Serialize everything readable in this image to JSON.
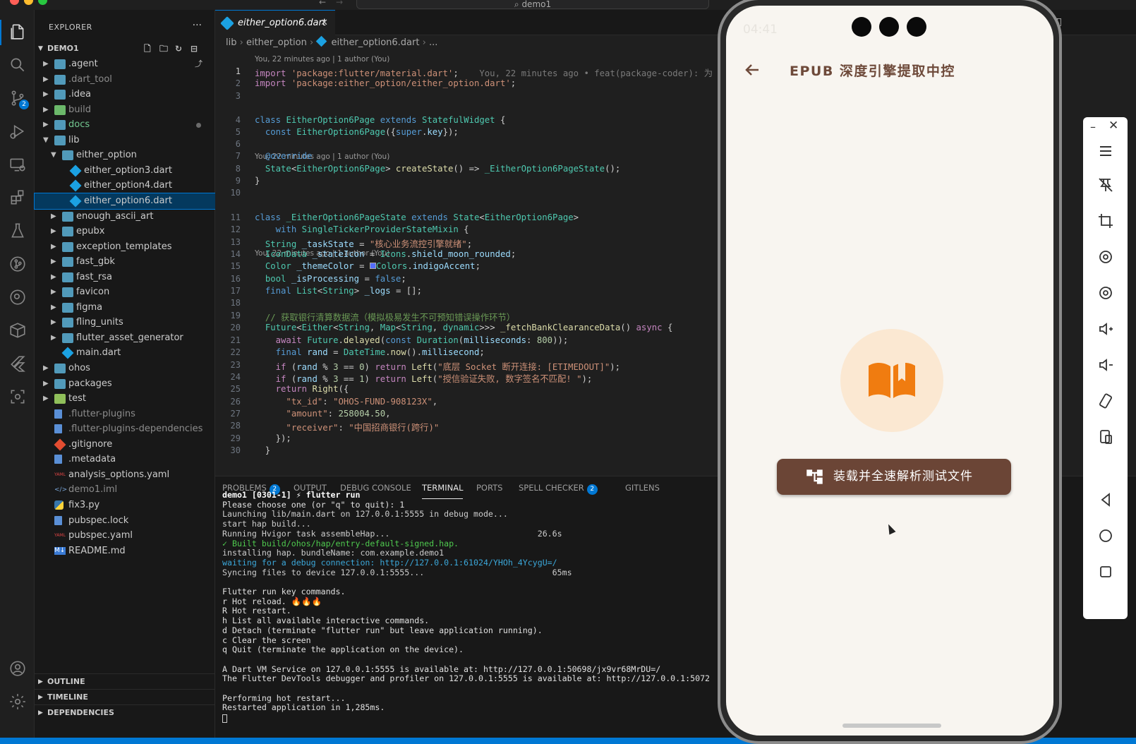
{
  "window": {
    "search_text": "demo1"
  },
  "activity": {
    "scm_badge": "2"
  },
  "explorer": {
    "title": "EXPLORER",
    "more": "···",
    "root": "DEMO1",
    "items": [
      {
        "label": ".agent",
        "kind": "folder",
        "depth": 0,
        "state": "closed"
      },
      {
        "label": ".dart_tool",
        "kind": "folder",
        "depth": 0,
        "state": "closed"
      },
      {
        "label": ".idea",
        "kind": "folder",
        "depth": 0,
        "state": "closed"
      },
      {
        "label": "build",
        "kind": "folder-build",
        "depth": 0,
        "state": "closed"
      },
      {
        "label": "docs",
        "kind": "folder",
        "depth": 0,
        "state": "closed"
      },
      {
        "label": "lib",
        "kind": "folder",
        "depth": 0,
        "state": "open"
      },
      {
        "label": "either_option",
        "kind": "folder",
        "depth": 1,
        "state": "open"
      },
      {
        "label": "either_option3.dart",
        "kind": "dart",
        "depth": 2
      },
      {
        "label": "either_option4.dart",
        "kind": "dart",
        "depth": 2
      },
      {
        "label": "either_option6.dart",
        "kind": "dart",
        "depth": 2,
        "selected": true
      },
      {
        "label": "enough_ascii_art",
        "kind": "folder",
        "depth": 1,
        "state": "closed"
      },
      {
        "label": "epubx",
        "kind": "folder",
        "depth": 1,
        "state": "closed"
      },
      {
        "label": "exception_templates",
        "kind": "folder",
        "depth": 1,
        "state": "closed"
      },
      {
        "label": "fast_gbk",
        "kind": "folder",
        "depth": 1,
        "state": "closed"
      },
      {
        "label": "fast_rsa",
        "kind": "folder",
        "depth": 1,
        "state": "closed"
      },
      {
        "label": "favicon",
        "kind": "folder",
        "depth": 1,
        "state": "closed"
      },
      {
        "label": "figma",
        "kind": "folder",
        "depth": 1,
        "state": "closed"
      },
      {
        "label": "fling_units",
        "kind": "folder",
        "depth": 1,
        "state": "closed"
      },
      {
        "label": "flutter_asset_generator",
        "kind": "folder",
        "depth": 1,
        "state": "closed"
      },
      {
        "label": "main.dart",
        "kind": "dart",
        "depth": 1
      },
      {
        "label": "ohos",
        "kind": "folder",
        "depth": 0,
        "state": "closed"
      },
      {
        "label": "packages",
        "kind": "folder",
        "depth": 0,
        "state": "closed"
      },
      {
        "label": "test",
        "kind": "folder-test",
        "depth": 0,
        "state": "closed"
      },
      {
        "label": ".flutter-plugins",
        "kind": "file",
        "depth": 0
      },
      {
        "label": ".flutter-plugins-dependencies",
        "kind": "file",
        "depth": 0
      },
      {
        "label": ".gitignore",
        "kind": "git",
        "depth": 0
      },
      {
        "label": ".metadata",
        "kind": "file",
        "depth": 0
      },
      {
        "label": "analysis_options.yaml",
        "kind": "yaml",
        "depth": 0
      },
      {
        "label": "demo1.iml",
        "kind": "xml",
        "depth": 0
      },
      {
        "label": "fix3.py",
        "kind": "python",
        "depth": 0
      },
      {
        "label": "pubspec.lock",
        "kind": "file",
        "depth": 0
      },
      {
        "label": "pubspec.yaml",
        "kind": "yaml",
        "depth": 0
      },
      {
        "label": "README.md",
        "kind": "md",
        "depth": 0
      }
    ],
    "sections": [
      "OUTLINE",
      "TIMELINE",
      "DEPENDENCIES"
    ]
  },
  "editor": {
    "tab_label": "either_option6.dart",
    "tab_close": "✕",
    "breadcrumb": [
      "lib",
      "either_option",
      "either_option6.dart",
      "..."
    ],
    "lens": "You, 22 minutes ago | 1 author (You)",
    "blame": "You, 22 minutes ago • feat(package-coder): 为",
    "line_numbers": [
      "1",
      "2",
      "3",
      "4",
      "5",
      "6",
      "7",
      "8",
      "9",
      "10",
      "11",
      "12",
      "13",
      "14",
      "15",
      "16",
      "17",
      "18",
      "19",
      "20",
      "21",
      "22",
      "23",
      "24",
      "25",
      "26",
      "27",
      "28",
      "29",
      "30"
    ]
  },
  "panel": {
    "tabs": [
      {
        "label": "PROBLEMS",
        "badge": "2"
      },
      {
        "label": "OUTPUT"
      },
      {
        "label": "DEBUG CONSOLE"
      },
      {
        "label": "TERMINAL",
        "active": true
      },
      {
        "label": "PORTS"
      },
      {
        "label": "SPELL CHECKER",
        "badge": "2"
      },
      {
        "label": "GITLENS"
      }
    ],
    "prompt": "demo1 [0301-1] ⚡ flutter run",
    "terminal_lines": [
      "Please choose one (or \"q\" to quit): 1",
      "Launching lib/main.dart on 127.0.0.1:5555 in debug mode...",
      "start hap build...",
      "Running Hvigor task assembleHap...                              26.6s",
      "✓ Built build/ohos/hap/entry-default-signed.hap.",
      "installing hap. bundleName: com.example.demo1",
      "waiting for a debug connection: http://127.0.0.1:61024/YHOh_4YcygU=/",
      "Syncing files to device 127.0.0.1:5555...                          65ms",
      "",
      "Flutter run key commands.",
      "r Hot reload. 🔥🔥🔥",
      "R Hot restart.",
      "h List all available interactive commands.",
      "d Detach (terminate \"flutter run\" but leave application running).",
      "c Clear the screen",
      "q Quit (terminate the application on the device).",
      "",
      "A Dart VM Service on 127.0.0.1:5555 is available at: http://127.0.0.1:50698/jx9vr68MrDU=/",
      "The Flutter DevTools debugger and profiler on 127.0.0.1:5555 is available at: http://127.0.0.1:5072",
      "",
      "Performing hot restart...",
      "Restarted application in 1,285ms."
    ]
  },
  "phone": {
    "time": "04:41",
    "app_title": "EPUB 深度引擎提取中控",
    "button_label": "装载并全速解析测试文件",
    "colors": {
      "bg": "#f8f5f0",
      "title": "#6e4a3a",
      "button": "#6b4536",
      "icon": "#f07c10",
      "circle": "#fbe8d2"
    }
  }
}
